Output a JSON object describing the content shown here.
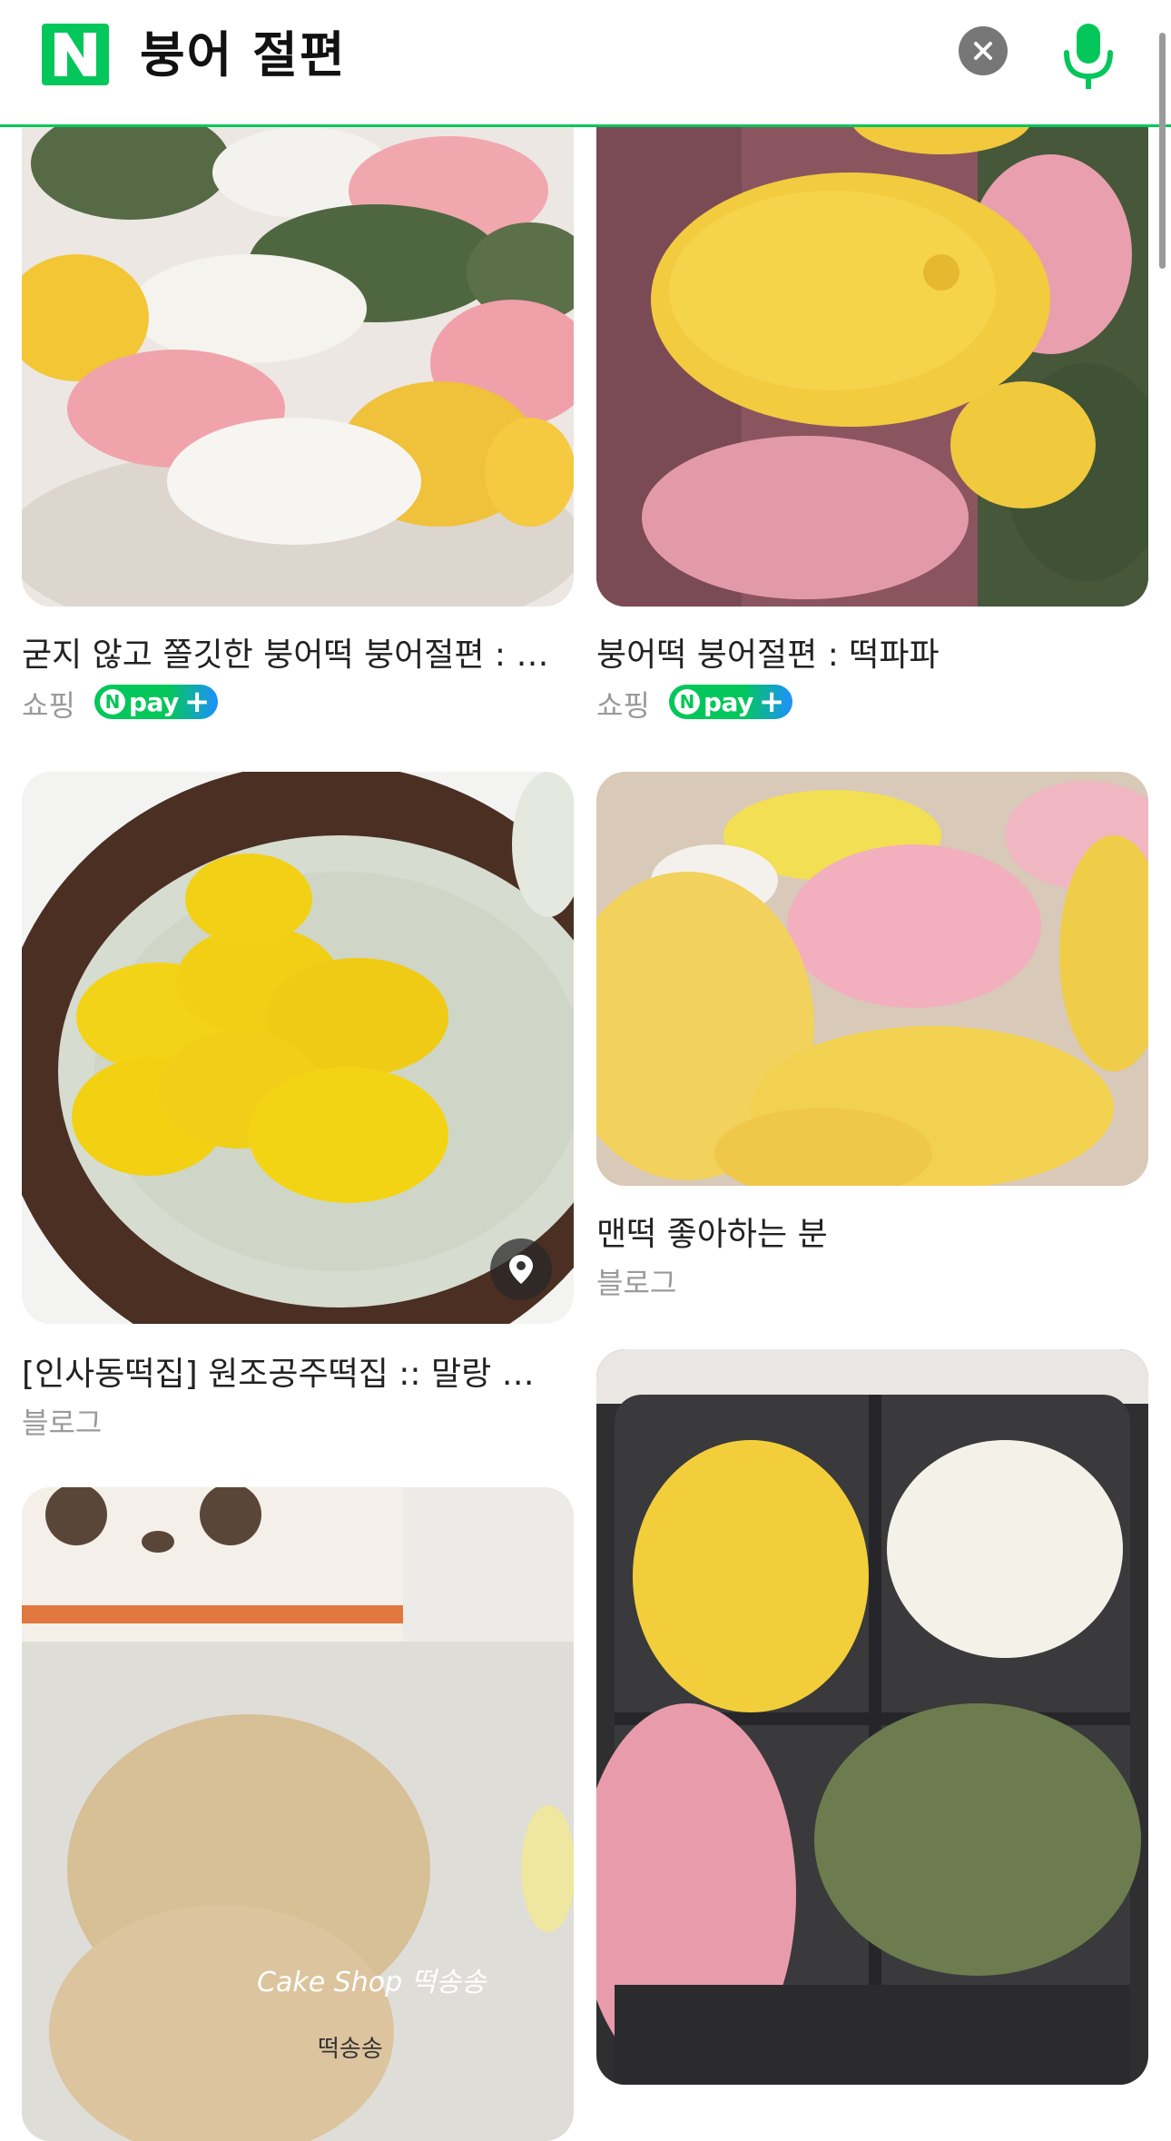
{
  "search": {
    "query": "붕어 절편",
    "logo_icon": "naver-n-logo",
    "clear_icon": "clear-icon",
    "mic_icon": "mic-icon"
  },
  "colors": {
    "brand": "#03c75a",
    "npay_blue": "#1e90ff"
  },
  "results": [
    {
      "title": "굳지 않고 쫄깃한 붕어떡 붕어절편 : …",
      "source": "쇼핑",
      "badge": {
        "n": "N",
        "text": "pay",
        "plus": "+"
      }
    },
    {
      "title": "붕어떡 붕어절편 : 떡파파",
      "source": "쇼핑",
      "badge": {
        "n": "N",
        "text": "pay",
        "plus": "+"
      }
    },
    {
      "title": "[인사동떡집] 원조공주떡집 :: 말랑 …",
      "source": "블로그",
      "pin_icon": "location-pin-icon"
    },
    {
      "title": "맨떡 좋아하는 분",
      "source": "블로그"
    },
    {
      "watermark": "Cake Shop 떡송송",
      "label": "떡송송"
    }
  ]
}
